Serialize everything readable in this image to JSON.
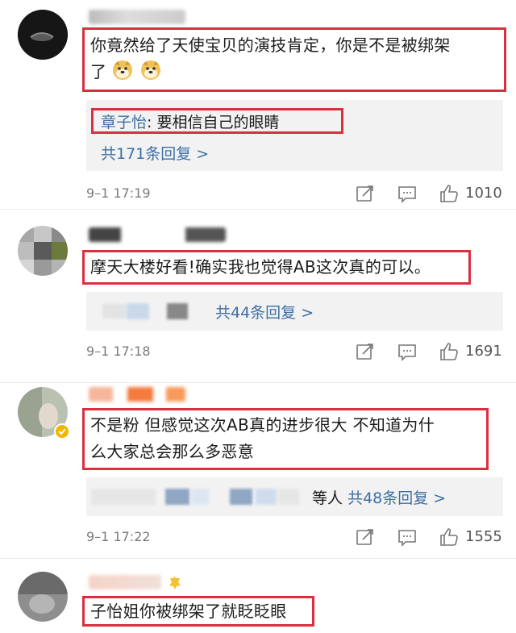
{
  "comments": [
    {
      "text_line1": "你竟然给了天使宝贝的演技肯定，你是不是被绑架",
      "text_line2": "了",
      "emoji": [
        "doge-emoji",
        "doge-emoji"
      ],
      "reply": {
        "author": "章子怡",
        "sep": ": ",
        "content": "要相信自己的眼睛"
      },
      "more": "共171条回复 >",
      "time": "9–1 17:19",
      "likes": "1010"
    },
    {
      "text_line1": "摩天大楼好看!确实我也觉得AB这次真的可以。",
      "more": "共44条回复 >",
      "time": "9–1 17:18",
      "likes": "1691"
    },
    {
      "text_line1": "不是粉 但感觉这次AB真的进步很大 不知道为什",
      "text_line2": "么大家总会那么多恶意",
      "more_prefix": "等人",
      "more": "共48条回复 >",
      "time": "9–1 17:22",
      "likes": "1555"
    },
    {
      "text_line1": "子怡姐你被绑架了就眨眨眼"
    }
  ],
  "colors": {
    "highlight": "#d93040",
    "link": "#3d6fa6",
    "meta": "#7a7a7a",
    "reply_bg": "#f2f2f2"
  },
  "icons": [
    "repost-icon",
    "comment-icon",
    "like-icon",
    "doge-emoji",
    "verified-badge-icon"
  ]
}
